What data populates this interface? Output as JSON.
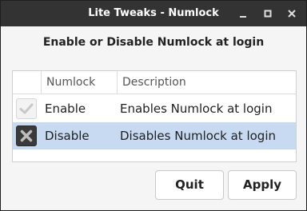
{
  "window": {
    "title": "Lite Tweaks - Numlock",
    "controls": [
      "minimize-icon",
      "maximize-icon",
      "close-icon"
    ]
  },
  "heading": "Enable or Disable Numlock at login",
  "list": {
    "columns": [
      "",
      "Numlock",
      "Description"
    ],
    "rows": [
      {
        "icon": "check-icon",
        "name": "Enable",
        "description": "Enables Numlock at login",
        "selected": false
      },
      {
        "icon": "x-icon",
        "name": "Disable",
        "description": "Disables Numlock at login",
        "selected": true
      }
    ]
  },
  "buttons": {
    "quit": "Quit",
    "apply": "Apply"
  },
  "colors": {
    "titlebar": "#333333",
    "selection": "#c7daf2"
  }
}
